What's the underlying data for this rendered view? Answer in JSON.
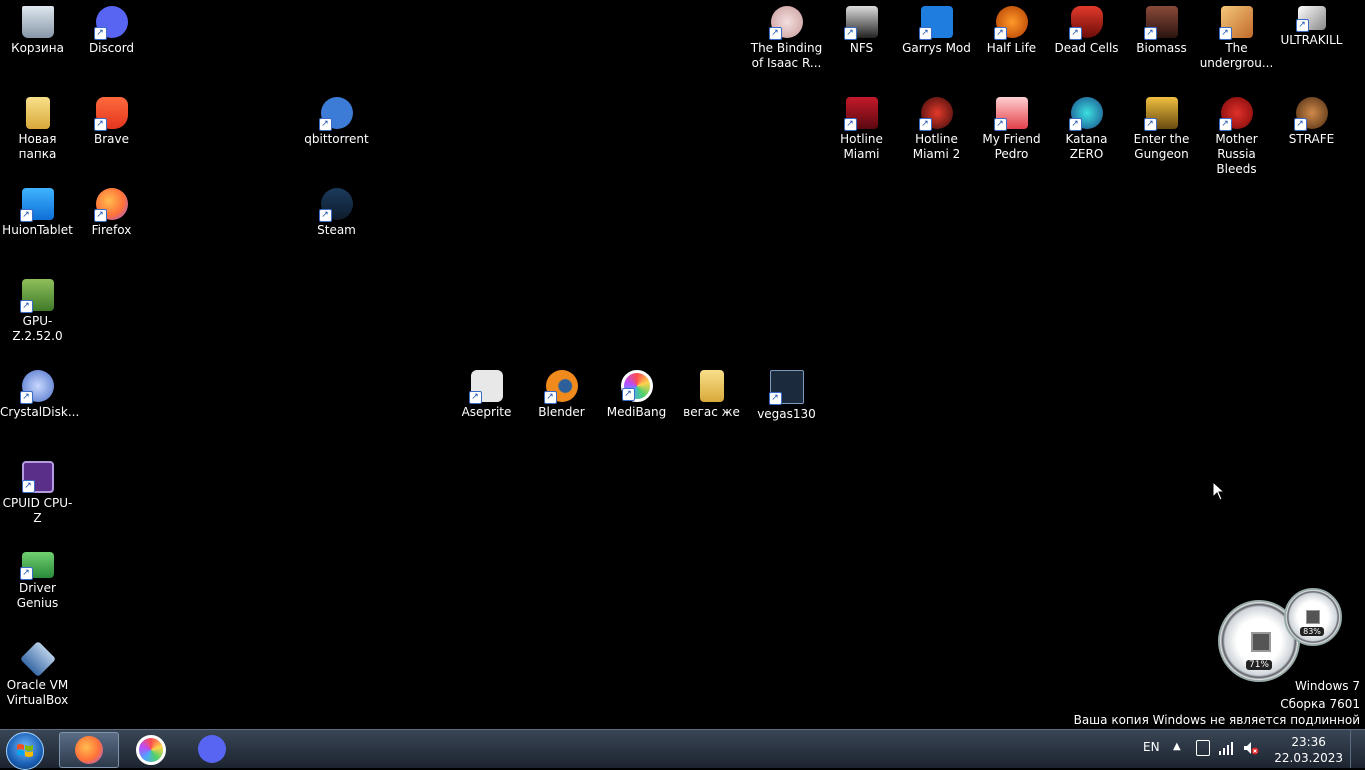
{
  "desktop": {
    "icons": [
      {
        "id": "recycle-bin",
        "label": "Корзина",
        "icon": "recycle-bin-icon"
      },
      {
        "id": "discord",
        "label": "Discord",
        "icon": "discord-icon"
      },
      {
        "id": "new-folder",
        "label": "Новая папка",
        "icon": "folder-icon"
      },
      {
        "id": "brave",
        "label": "Brave",
        "icon": "brave-icon"
      },
      {
        "id": "qbittorrent",
        "label": "qbittorrent",
        "icon": "qbittorrent-icon"
      },
      {
        "id": "huion",
        "label": "HuionTablet",
        "icon": "huion-icon"
      },
      {
        "id": "firefox",
        "label": "Firefox",
        "icon": "firefox-icon"
      },
      {
        "id": "steam",
        "label": "Steam",
        "icon": "steam-icon"
      },
      {
        "id": "gpuz",
        "label": "GPU-Z.2.52.0",
        "icon": "gpu-z-icon"
      },
      {
        "id": "crystaldisk",
        "label": "CrystalDisk...",
        "icon": "crystaldisk-icon"
      },
      {
        "id": "cpuz",
        "label": "CPUID CPU-Z",
        "icon": "cpu-z-icon"
      },
      {
        "id": "drivergenius",
        "label": "Driver Genius",
        "icon": "driver-genius-icon"
      },
      {
        "id": "virtualbox",
        "label": "Oracle VM VirtualBox",
        "icon": "virtualbox-icon"
      },
      {
        "id": "aseprite",
        "label": "Aseprite",
        "icon": "aseprite-icon"
      },
      {
        "id": "blender",
        "label": "Blender",
        "icon": "blender-icon"
      },
      {
        "id": "medibang",
        "label": "MediBang",
        "icon": "medibang-icon"
      },
      {
        "id": "vegas-folder",
        "label": "вегас же",
        "icon": "folder-icon"
      },
      {
        "id": "vegas130",
        "label": "vegas130",
        "icon": "vegas-icon"
      },
      {
        "id": "isaac",
        "label": "The Binding of Isaac R...",
        "icon": "isaac-icon"
      },
      {
        "id": "nfs",
        "label": "NFS",
        "icon": "nfs-icon"
      },
      {
        "id": "garrysmod",
        "label": "Garrys Mod",
        "icon": "gmod-icon"
      },
      {
        "id": "halflife",
        "label": "Half Life",
        "icon": "half-life-icon"
      },
      {
        "id": "deadcells",
        "label": "Dead Cells",
        "icon": "dead-cells-icon"
      },
      {
        "id": "biomass",
        "label": "Biomass",
        "icon": "biomass-icon"
      },
      {
        "id": "underground",
        "label": "The undergrou...",
        "icon": "underground-icon"
      },
      {
        "id": "ultrakill",
        "label": "ULTRAKILL",
        "icon": "ultrakill-icon"
      },
      {
        "id": "hotline1",
        "label": "Hotline Miami",
        "icon": "hotline-miami-icon"
      },
      {
        "id": "hotline2",
        "label": "Hotline Miami 2",
        "icon": "hotline-miami-2-icon"
      },
      {
        "id": "pedro",
        "label": "My Friend Pedro",
        "icon": "pedro-icon"
      },
      {
        "id": "katana",
        "label": "Katana ZERO",
        "icon": "katana-zero-icon"
      },
      {
        "id": "gungeon",
        "label": "Enter the Gungeon",
        "icon": "gungeon-icon"
      },
      {
        "id": "mrb",
        "label": "Mother Russia Bleeds",
        "icon": "mother-russia-icon"
      },
      {
        "id": "strafe",
        "label": "STRAFE",
        "icon": "strafe-icon"
      }
    ]
  },
  "gadget": {
    "cpu_percent": "71%",
    "ram_percent": "83%"
  },
  "watermark": {
    "line1": "Windows 7",
    "line2": "Сборка 7601",
    "line3": "Ваша копия Windows не является подлинной"
  },
  "taskbar": {
    "apps": [
      {
        "name": "Firefox",
        "icon": "firefox-icon"
      },
      {
        "name": "MediBang",
        "icon": "medibang-icon"
      },
      {
        "name": "Discord",
        "icon": "discord-icon"
      }
    ],
    "language": "EN",
    "time": "23:36",
    "date": "22.03.2023"
  },
  "colors": {
    "desktop_bg": "#000000",
    "taskbar": "#26303d",
    "discord": "#5865f2",
    "firefox": "#ff7139"
  }
}
